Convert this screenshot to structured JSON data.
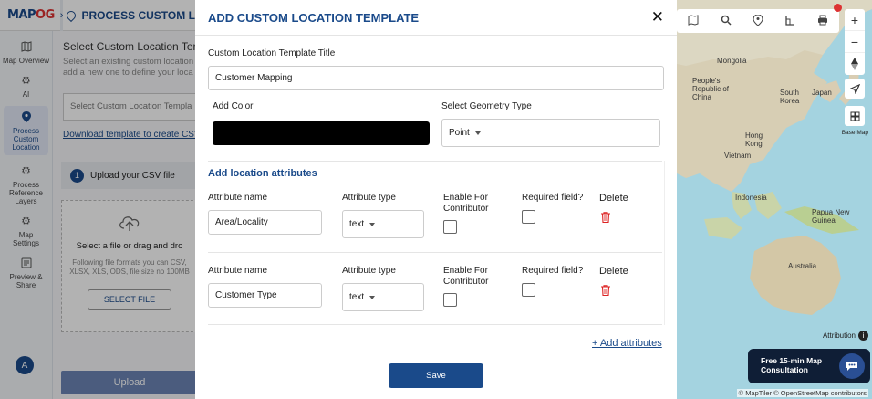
{
  "app": {
    "logo_main": "MAP",
    "logo_accent": "OG",
    "page_title": "PROCESS CUSTOM LOCATI"
  },
  "rail": [
    {
      "label": "Map Overview",
      "icon": "map-icon"
    },
    {
      "label": "AI",
      "icon": "gear-icon"
    },
    {
      "label": "Process Custom Location",
      "icon": "location-pin-icon",
      "active": true
    },
    {
      "label": "Process Reference Layers",
      "icon": "gear-icon"
    },
    {
      "label": "Map Settings",
      "icon": "gear-icon"
    },
    {
      "label": "Preview & Share",
      "icon": "preview-icon"
    }
  ],
  "avatar": "A",
  "panel": {
    "heading": "Select Custom Location Templ",
    "sub1": "Select an existing custom location",
    "sub2": "add a new one to define your loca",
    "select_placeholder": "Select Custom Location Templa",
    "download_link": "Download template to create CSV",
    "step_num": "1",
    "step_label": "Upload your CSV file",
    "drop_title": "Select a file or drag and dro",
    "drop_formats": "Following file formats you can CSV, XLSX, XLS, ODS, file size no 100MB",
    "select_file": "SELECT FILE",
    "upload": "Upload"
  },
  "modal": {
    "title": "ADD CUSTOM LOCATION TEMPLATE",
    "template_title_label": "Custom Location Template Title",
    "template_title_value": "Customer Mapping",
    "add_color_label": "Add Color",
    "color_value": "#000000",
    "geometry_label": "Select Geometry Type",
    "geometry_value": "Point",
    "attributes_section": "Add location attributes",
    "col_name": "Attribute name",
    "col_type": "Attribute type",
    "col_contributor_1": "Enable For",
    "col_contributor_2": "Contributor",
    "col_required": "Required field?",
    "col_delete": "Delete",
    "attributes": [
      {
        "name": "Area/Locality",
        "type": "text",
        "contributor": false,
        "required": false
      },
      {
        "name": "Customer Type",
        "type": "text",
        "contributor": false,
        "required": false
      }
    ],
    "add_attributes": "+ Add attributes",
    "save": "Save"
  },
  "map": {
    "labels": {
      "mongolia": "Mongolia",
      "china": "People's Republic of China",
      "south_korea": "South Korea",
      "japan": "Japan",
      "hong_kong": "Hong Kong",
      "vietnam": "Vietnam",
      "indonesia": "Indonesia",
      "png": "Papua New Guinea",
      "australia": "Australia"
    },
    "basemap": "Base Map",
    "attribution": "Attribution",
    "consult_line1": "Free 15-min Map",
    "consult_line2": "Consultation",
    "copyright": "© MapTiler © OpenStreetMap contributors"
  }
}
